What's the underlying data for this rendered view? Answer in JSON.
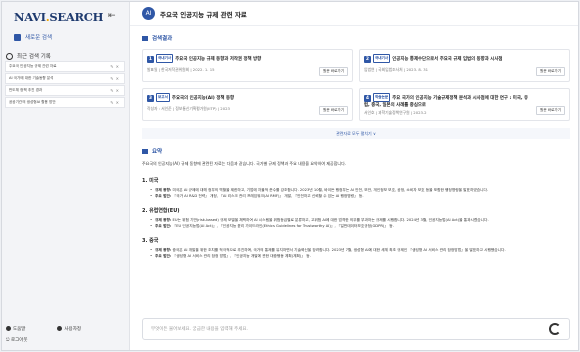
{
  "sidebar": {
    "logo_main": "NAVI",
    "logo_dot": ".",
    "logo_tail": "SEARCH",
    "toggle": "⇤",
    "new_search": "새로운 검색",
    "history_title": "최근 검색 기록",
    "history": [
      "주요국 인공지능 규제 관련 자료",
      "AI 국가에 대한 기술동향 분석",
      "반도체 정책 추진 경과",
      "공공기관의 생성형AI 활용 방안"
    ],
    "help": "도움말",
    "user": "사용자정",
    "logout": "로그아웃"
  },
  "header": {
    "badge": "AI",
    "title": "주요국 인공지능 규제 관련 자료"
  },
  "results_section": {
    "title": "검색결과"
  },
  "results": [
    {
      "num": "1",
      "tag": "국내기사",
      "title": "주요국 인공지능 규제 동향과 저작권 정책 방향",
      "meta": "발표일 | 한국저작권위원회 | 2022. 1. 15",
      "button": "원문 바로가기"
    },
    {
      "num": "2",
      "tag": "국내기사",
      "title": "인공지능 통제수단으로서 주요국 규제 입법의 동향과 시사점",
      "meta": "입법연 | 국회입법조사처 | 2023. 8. 31",
      "button": "원문 바로가기"
    },
    {
      "num": "3",
      "tag": "보고서",
      "title": "주요국의 인공지능(AI) 정책 동향",
      "meta": "작성자 : 서인준 | 정보통신기획평가원(IITP) | 2023",
      "button": "원문 바로가기"
    },
    {
      "num": "4",
      "tag": "학술논문",
      "title": "주요 국가의 인공지능 기술규제정책 분석과 시사점에 대한 연구 : 미국, 유럽, 중국, 일본의 사례를 중심으로",
      "meta": "서인호 | 과학기술정책연구원 | 2023.2",
      "button": "원문 바로가기"
    }
  ],
  "more_label": "관련자료 모두 펼치기 ∨",
  "summary_section": {
    "title": "요약"
  },
  "summary": {
    "intro": "주요국의 인공지능(AI) 규제 동향에 관련된 자료는 다음과 같습니다. 국가별 규제 정책과 주요 내용을 요약하여 제공합니다.",
    "sections": [
      {
        "heading": "1. 미국",
        "items": [
          {
            "label": "규제 동향:",
            "text": "미국은 AI 규제에 대해 정부의 역할을 제한하고, 기업에 자율적 준수를 강조합니다. 2023년 10월, 바이든 행정부는 AI 안전, 보안, 개인정보 보호, 공정, 소비자 보호 등을 포함한 행정명령을 발표하였습니다."
          },
          {
            "label": "주요 법안:",
            "text": "『국가 AI R&D 전략』 개정, 『AI 리스크 관리 프레임워크(AI RMF)』 개발, 『안전하고 신뢰할 수 있는 AI 행정명령』 등."
          }
        ]
      },
      {
        "heading": "2. 유럽연합(EU)",
        "items": [
          {
            "label": "규제 동향:",
            "text": "EU는 위험 기반(risk-based) 규제 모델을 채택하여 AI 시스템을 위험등급별로 분류하고, 고위험 AI에 대한 엄격한 의무를 부과하는 규제를 시행합니다. 2024년 3월, 인공지능법(AI Act)을 통과시켰습니다."
          },
          {
            "label": "주요 법안:",
            "text": "『EU 인공지능법(AI Act)』, 『인공지능 윤리 가이드라인(Ethics Guidelines for Trustworthy AI)』, 『일반데이터보호규정(GDPR)』 등."
          }
        ]
      },
      {
        "heading": "3. 중국",
        "items": [
          {
            "label": "규제 동향:",
            "text": "중국은 AI 개발을 위한 조치를 적극적으로 추진하며, 국가의 통제를 유지하면서 기술혁신을 장려합니다. 2023년 7월, 생성형 AI에 대한 세계 최초 규제인 『생성형 AI 서비스 관리 잠정방법』을 발표하고 시행했습니다."
          },
          {
            "label": "주요 법안:",
            "text": "『생성형 AI 서비스 관리 잠정 방법』, 『인공지능 개발에 관한 대중행동 계획(계획)』 등."
          }
        ]
      }
    ]
  },
  "input": {
    "placeholder": "무엇이든 물어보세요. 궁금한 내용을 입력해 주세요."
  }
}
